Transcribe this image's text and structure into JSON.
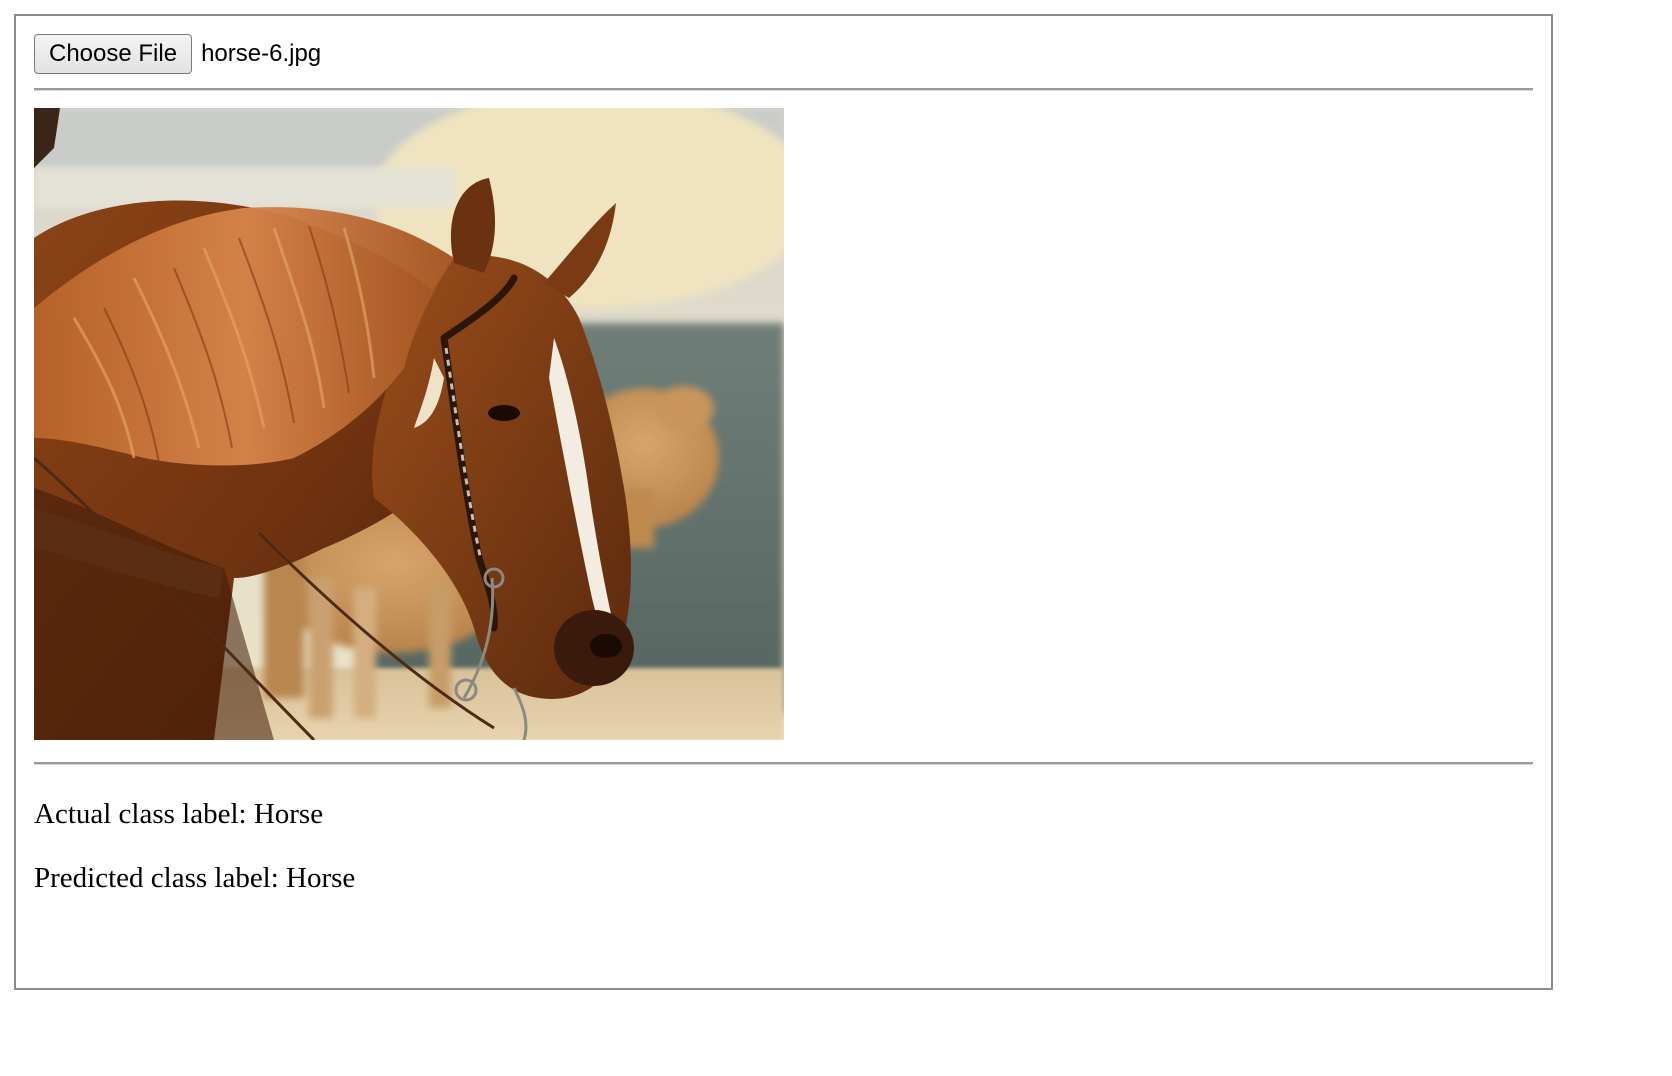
{
  "file_input": {
    "button_label": "Choose File",
    "selected_file": "horse-6.jpg"
  },
  "image": {
    "alt": "horse-6.jpg"
  },
  "results": {
    "actual_label": "Actual class label: Horse",
    "predicted_label": "Predicted class label: Horse"
  }
}
